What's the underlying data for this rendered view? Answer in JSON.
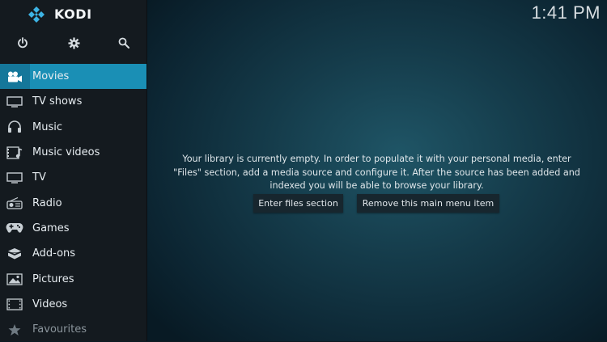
{
  "app": {
    "name": "KODI",
    "clock": "1:41 PM"
  },
  "top_icons": [
    {
      "name": "power-icon"
    },
    {
      "name": "gear-icon"
    },
    {
      "name": "search-icon"
    }
  ],
  "menu": {
    "items": [
      {
        "label": "Movies",
        "icon": "movie-camera-icon",
        "active": true
      },
      {
        "label": "TV shows",
        "icon": "tv-icon"
      },
      {
        "label": "Music",
        "icon": "headphones-icon"
      },
      {
        "label": "Music videos",
        "icon": "music-video-icon"
      },
      {
        "label": "TV",
        "icon": "tv-icon"
      },
      {
        "label": "Radio",
        "icon": "radio-icon"
      },
      {
        "label": "Games",
        "icon": "gamepad-icon"
      },
      {
        "label": "Add-ons",
        "icon": "addons-box-icon"
      },
      {
        "label": "Pictures",
        "icon": "picture-icon"
      },
      {
        "label": "Videos",
        "icon": "film-strip-icon"
      },
      {
        "label": "Favourites",
        "icon": "star-icon"
      }
    ]
  },
  "main": {
    "message_lines": [
      "Your library is currently empty. In order to populate it with your personal media, enter",
      "\"Files\" section, add a media source and configure it. After the source has been added and",
      "indexed you will be able to browse your library."
    ],
    "enter_files_label": "Enter files section",
    "remove_item_label": "Remove this main menu item"
  },
  "colors": {
    "accent": "#1a8fb5",
    "sidebar": "#141a1f",
    "background": "#153c4b"
  }
}
